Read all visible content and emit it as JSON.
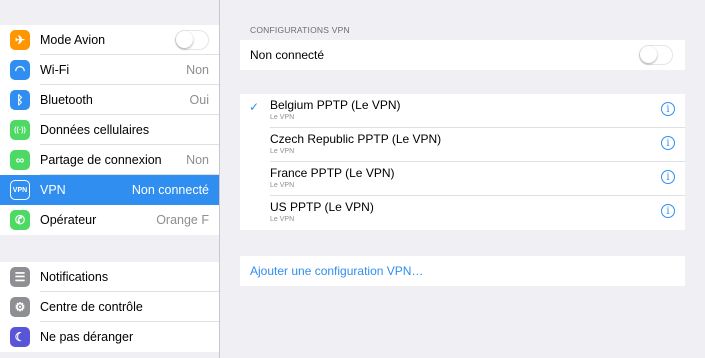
{
  "sidebar": {
    "group1": [
      {
        "label": "Mode Avion",
        "value": "",
        "icon": "airplane-icon",
        "color": "#ff9500",
        "toggle": true
      },
      {
        "label": "Wi-Fi",
        "value": "Non",
        "icon": "wifi-icon",
        "color": "#2f8ef0"
      },
      {
        "label": "Bluetooth",
        "value": "Oui",
        "icon": "bluetooth-icon",
        "color": "#2f8ef0"
      },
      {
        "label": "Données cellulaires",
        "value": "",
        "icon": "cellular-icon",
        "color": "#4cd964"
      },
      {
        "label": "Partage de connexion",
        "value": "Non",
        "icon": "hotspot-icon",
        "color": "#4cd964"
      },
      {
        "label": "VPN",
        "value": "Non connecté",
        "icon": "vpn-icon",
        "color": "#2f8ef0",
        "selected": true
      },
      {
        "label": "Opérateur",
        "value": "Orange F",
        "icon": "phone-icon",
        "color": "#4cd964"
      }
    ],
    "group2": [
      {
        "label": "Notifications",
        "icon": "notifications-icon",
        "color": "#8e8e93"
      },
      {
        "label": "Centre de contrôle",
        "icon": "control-center-icon",
        "color": "#8e8e93"
      },
      {
        "label": "Ne pas déranger",
        "icon": "moon-icon",
        "color": "#5856d6"
      }
    ]
  },
  "main": {
    "section_header": "CONFIGURATIONS VPN",
    "status_label": "Non connecté",
    "configs": [
      {
        "name": "Belgium PPTP (Le VPN)",
        "sub": "Le VPN",
        "checked": true
      },
      {
        "name": "Czech Republic PPTP (Le VPN)",
        "sub": "Le VPN",
        "checked": false
      },
      {
        "name": "France PPTP (Le VPN)",
        "sub": "Le VPN",
        "checked": false
      },
      {
        "name": "US PPTP (Le VPN)",
        "sub": "Le VPN",
        "checked": false
      }
    ],
    "check_glyph": "✓",
    "info_glyph": "i",
    "add_label": "Ajouter une configuration VPN…"
  }
}
